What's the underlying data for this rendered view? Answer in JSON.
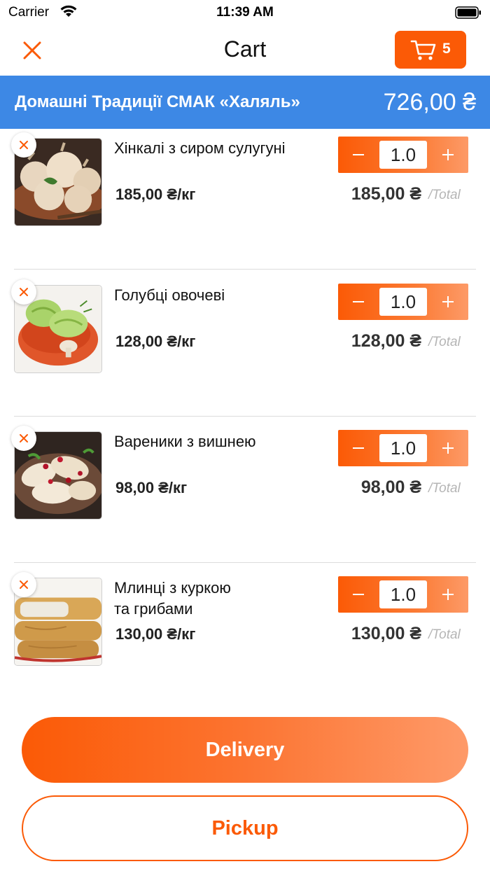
{
  "status_bar": {
    "carrier": "Carrier",
    "time": "11:39 AM"
  },
  "navbar": {
    "title": "Cart",
    "cart_count": "5"
  },
  "store": {
    "name": "Домашні Традиції СМАК «Халяль»",
    "total": "726,00 ₴"
  },
  "items": [
    {
      "name": "Хінкалі з сиром сулугуні",
      "price": "185,00 ₴/кг",
      "quantity": "1.0",
      "total": "185,00 ₴",
      "total_label": "/Total",
      "image": "khinkali-photo"
    },
    {
      "name": "Голубці  овочеві",
      "price": "128,00 ₴/кг",
      "quantity": "1.0",
      "total": "128,00 ₴",
      "total_label": "/Total",
      "image": "cabbage-rolls-photo"
    },
    {
      "name": "Вареники з вишнею",
      "price": "98,00 ₴/кг",
      "quantity": "1.0",
      "total": "98,00 ₴",
      "total_label": "/Total",
      "image": "cherry-dumplings-photo"
    },
    {
      "name": "Млинці  з  куркою\nта  грибами",
      "price": "130,00 ₴/кг",
      "quantity": "1.0",
      "total": "130,00 ₴",
      "total_label": "/Total",
      "image": "pancakes-photo"
    }
  ],
  "actions": {
    "delivery": "Delivery",
    "pickup": "Pickup"
  },
  "colors": {
    "accent": "#fb5a06",
    "store_bar": "#3d88e5"
  }
}
